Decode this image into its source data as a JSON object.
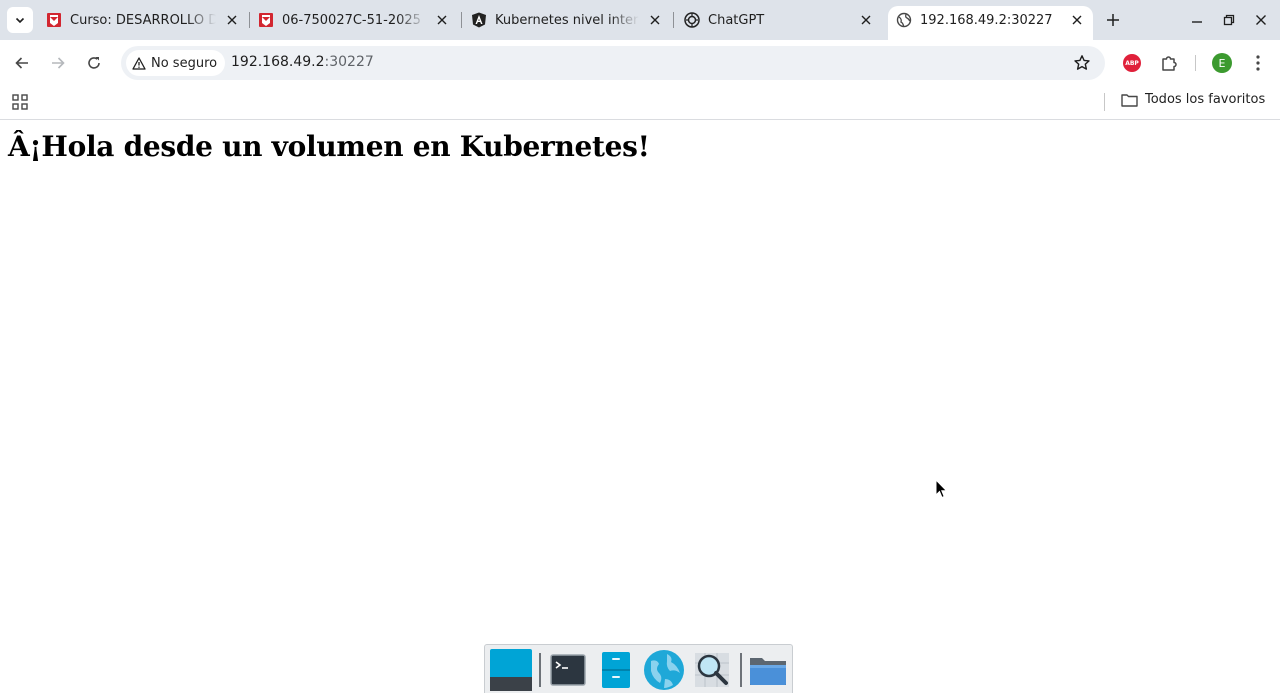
{
  "browser": {
    "tabs": [
      {
        "title": "Curso: DESARROLLO DE APLICACIONES",
        "favicon": "red-shield-icon",
        "active": false
      },
      {
        "title": "06-750027C-51-2025",
        "favicon": "red-shield-icon",
        "active": false
      },
      {
        "title": "Kubernetes nivel intermedio",
        "favicon": "angular-icon",
        "active": false
      },
      {
        "title": "ChatGPT",
        "favicon": "openai-icon",
        "active": false
      },
      {
        "title": "192.168.49.2:30227",
        "favicon": "globe-icon",
        "active": true
      }
    ],
    "security_label": "No seguro",
    "url_host": "192.168.49.2",
    "url_rest": ":30227",
    "profile_initial": "E",
    "abp_label": "ABP",
    "bookmarks_folder": "Todos los favoritos"
  },
  "page": {
    "heading": "Â¡Hola desde un volumen en Kubernetes!"
  },
  "dock": {
    "items": [
      "desktop-icon",
      "terminal-icon",
      "file-cabinet-icon",
      "web-browser-icon",
      "app-finder-icon",
      "folder-icon"
    ]
  },
  "colors": {
    "tabstrip": "#dee3ea",
    "omnibox": "#eef1f5",
    "abp": "#e0203a",
    "profile": "#3c9a2f"
  }
}
